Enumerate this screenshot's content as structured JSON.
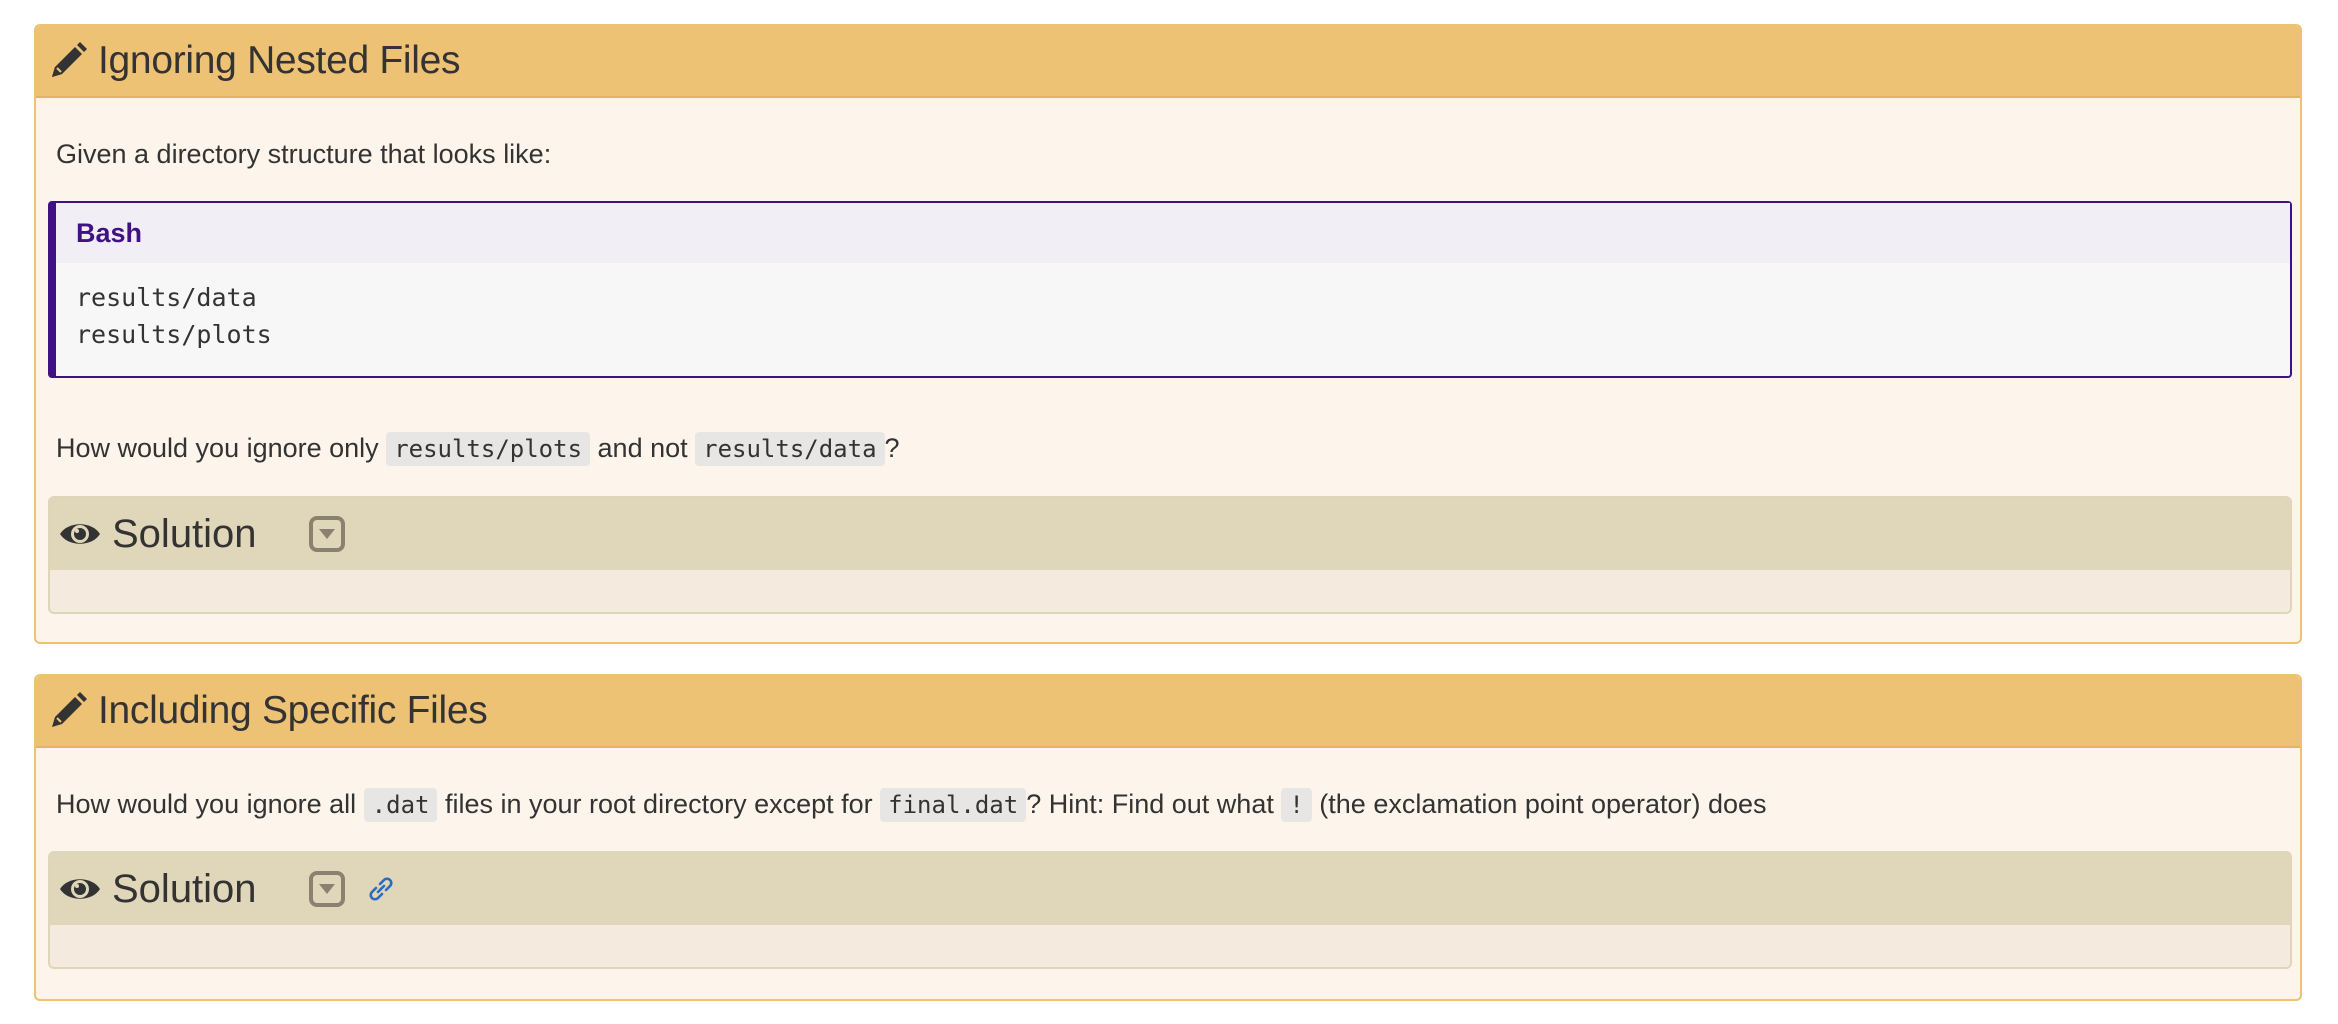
{
  "challenges": [
    {
      "title": "Ignoring Nested Files",
      "intro": "Given a directory structure that looks like:",
      "code_block": {
        "language": "Bash",
        "lines": [
          "results/data",
          "results/plots"
        ]
      },
      "question": {
        "before": "How would you ignore only ",
        "code1": "results/plots",
        "middle": " and not ",
        "code2": "results/data",
        "after": "?"
      },
      "solution_title": "Solution"
    },
    {
      "title": "Including Specific Files",
      "question": {
        "part1": "How would you ignore all ",
        "code1": ".dat",
        "part2": " files in your root directory except for ",
        "code2": "final.dat",
        "part3": "? Hint: Find out what ",
        "code3": "!",
        "part4": " (the exclamation point operator) does"
      },
      "solution_title": "Solution"
    }
  ],
  "icons": {
    "challenge": "pencil-icon",
    "solution": "eye-icon",
    "toggle": "caret-square-down-icon",
    "anchor": "link-icon"
  },
  "colors": {
    "challenge_header": "#eec275",
    "challenge_body": "#fdf5eb",
    "solution_header": "#e0d6b9",
    "code_accent": "#3f1185",
    "link": "#2a6dbf"
  }
}
